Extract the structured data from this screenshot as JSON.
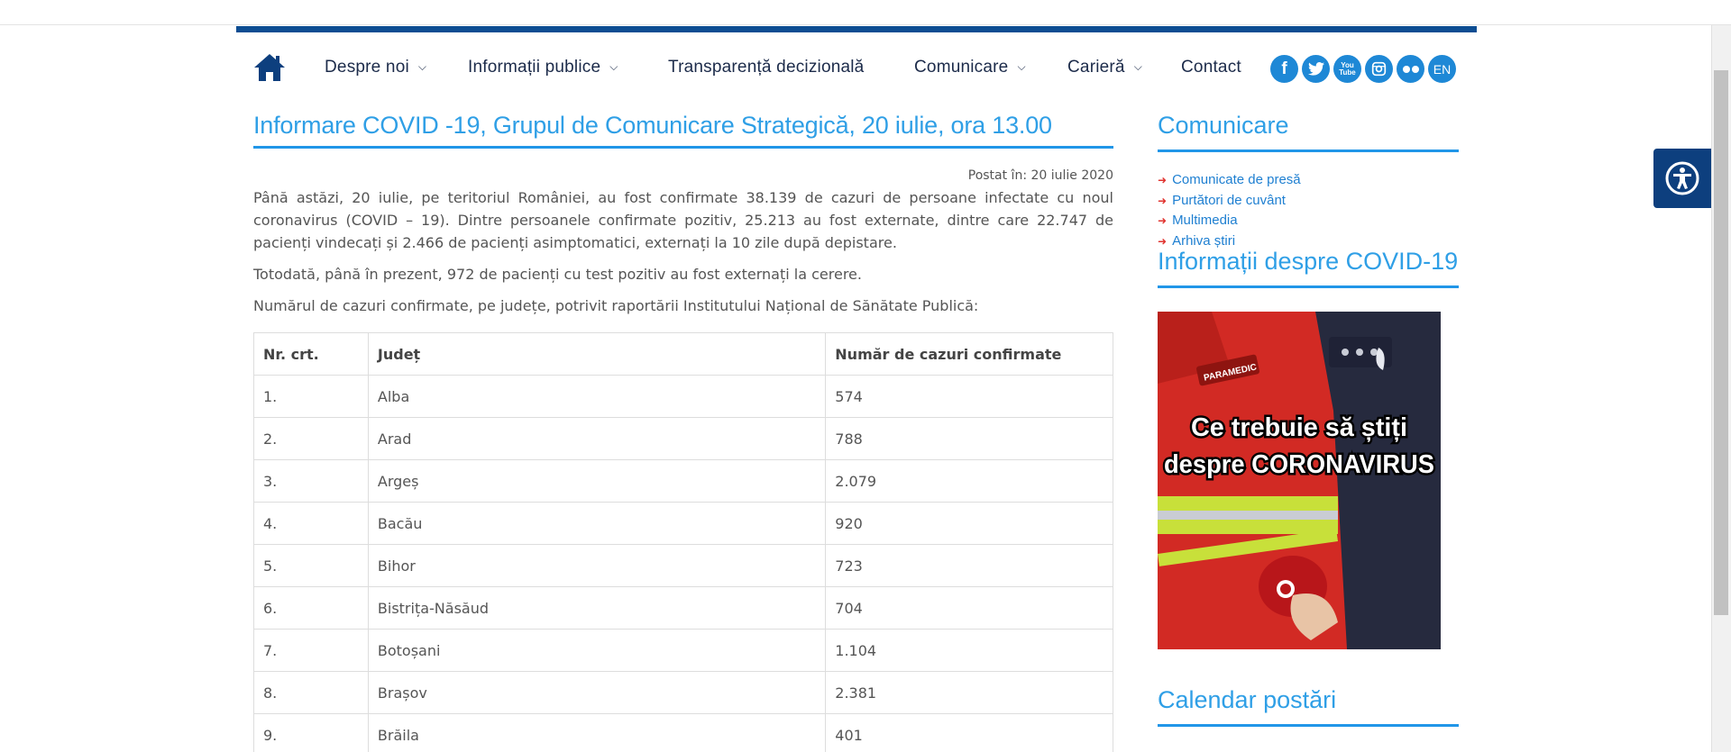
{
  "nav": {
    "items": [
      {
        "label": "Despre noi",
        "has_dropdown": true
      },
      {
        "label": "Informații publice",
        "has_dropdown": true
      },
      {
        "label": "Transparență decizională",
        "has_dropdown": false
      },
      {
        "label": "Comunicare",
        "has_dropdown": true
      },
      {
        "label": "Carieră",
        "has_dropdown": true
      },
      {
        "label": "Contact",
        "has_dropdown": false
      }
    ],
    "social": [
      {
        "icon": "facebook-icon",
        "glyph": "f"
      },
      {
        "icon": "twitter-icon",
        "glyph": ""
      },
      {
        "icon": "youtube-icon",
        "glyph": "You\nTube"
      },
      {
        "icon": "instagram-icon",
        "glyph": ""
      },
      {
        "icon": "flickr-icon",
        "glyph": ""
      },
      {
        "icon": "language-icon",
        "glyph": "EN"
      }
    ]
  },
  "article": {
    "title": "Informare COVID -19, Grupul de Comunicare Strategică, 20 iulie, ora 13.00",
    "posted": "Postat în: 20 iulie 2020",
    "paragraph1": "Până astăzi, 20 iulie, pe teritoriul României, au fost confirmate 38.139 de cazuri de persoane infectate cu noul coronavirus (COVID – 19). Dintre persoanele confirmate pozitiv, 25.213 au fost externate, dintre care 22.747 de pacienți vindecați și 2.466 de pacienți asimptomatici, externați la 10 zile după depistare.",
    "paragraph2": "Totodată, până în prezent, 972 de pacienți cu test pozitiv au fost externați la cerere.",
    "paragraph3": "Numărul de cazuri confirmate, pe județe, potrivit raportării Institutului Național de Sănătate Publică:"
  },
  "table": {
    "headers": [
      "Nr. crt.",
      "Județ",
      "Număr de cazuri confirmate"
    ],
    "rows": [
      [
        "1.",
        "Alba",
        "574"
      ],
      [
        "2.",
        "Arad",
        "788"
      ],
      [
        "3.",
        "Argeș",
        "2.079"
      ],
      [
        "4.",
        "Bacău",
        "920"
      ],
      [
        "5.",
        "Bihor",
        "723"
      ],
      [
        "6.",
        "Bistrița-Năsăud",
        "704"
      ],
      [
        "7.",
        "Botoșani",
        "1.104"
      ],
      [
        "8.",
        "Brașov",
        "2.381"
      ],
      [
        "9.",
        "Brăila",
        "401"
      ]
    ]
  },
  "sidebar": {
    "comunicare_title": "Comunicare",
    "links": [
      "Comunicate de presă",
      "Purtători de cuvânt",
      "Multimedia",
      "Arhiva știri"
    ],
    "covid_title": "Informații despre COVID-19",
    "covid_image_text_line1": "Ce trebuie să știți",
    "covid_image_text_line2": "despre CORONAVIRUS",
    "covid_image_badge": "PARAMEDIC",
    "calendar_title": "Calendar postări"
  },
  "colors": {
    "navy": "#0d4d92",
    "accent_blue": "#2196e8",
    "link_blue": "#1e7fd1",
    "arrow_red": "#e0322e"
  }
}
